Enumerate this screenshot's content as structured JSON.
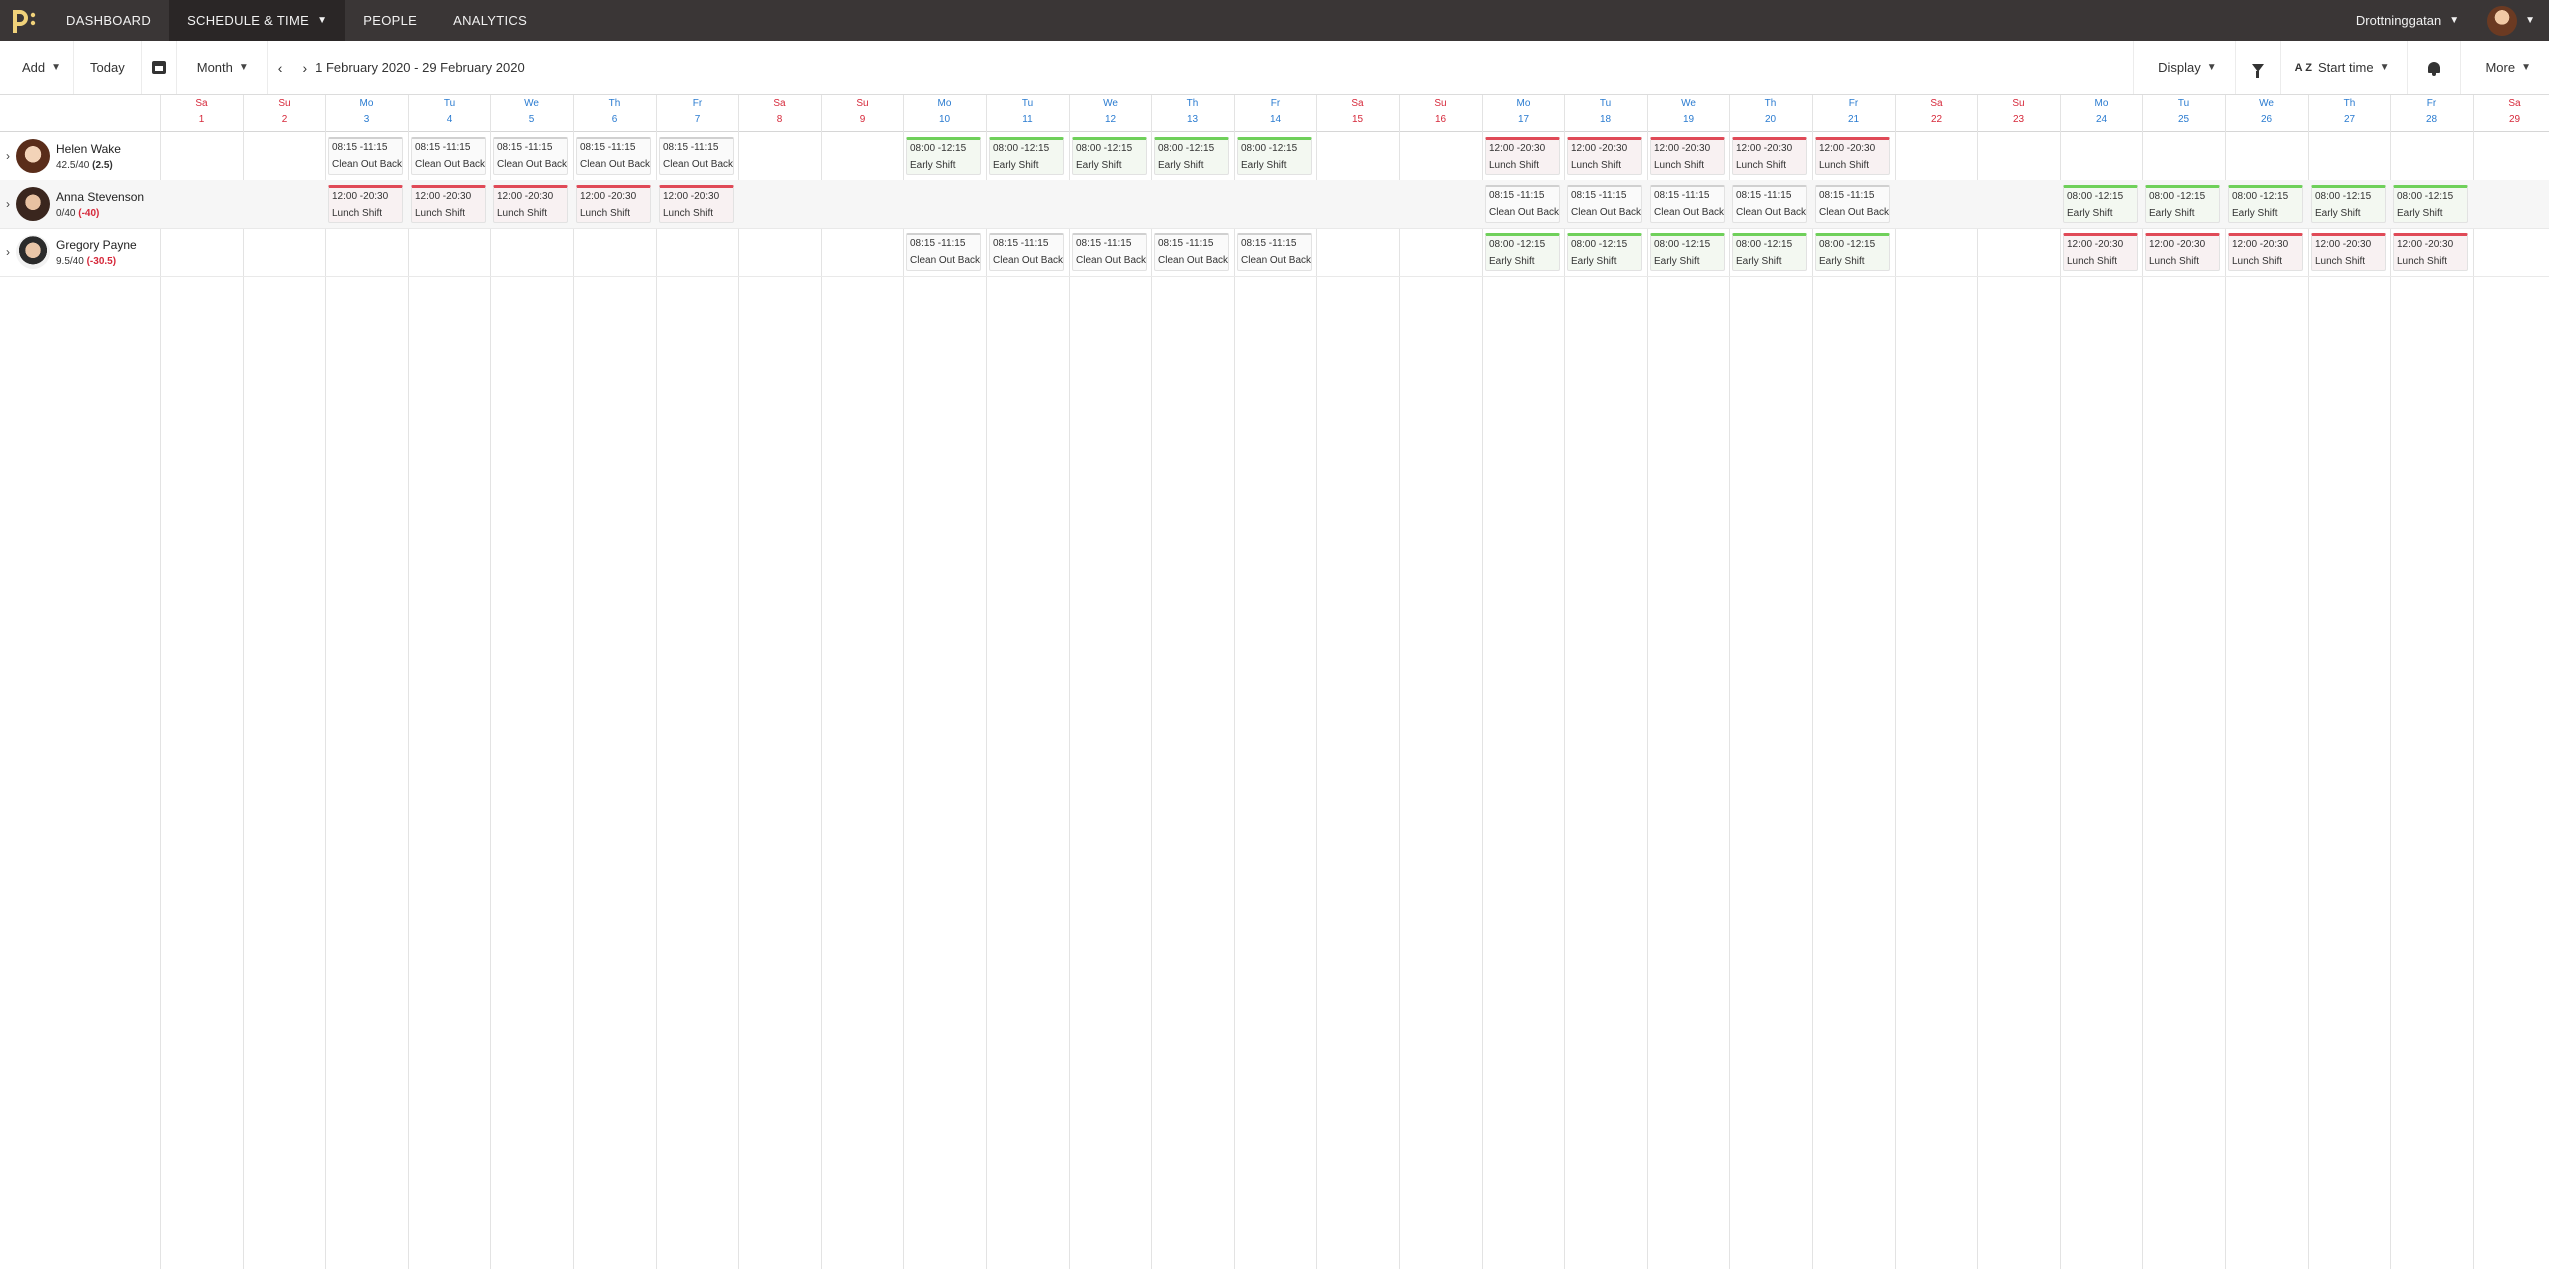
{
  "nav": {
    "items": [
      "DASHBOARD",
      "SCHEDULE & TIME",
      "PEOPLE",
      "ANALYTICS"
    ],
    "active_index": 1,
    "location": "Drottninggatan"
  },
  "toolbar": {
    "add_label": "Add",
    "today_label": "Today",
    "view_label": "Month",
    "date_range": "1 February 2020 - 29 February 2020",
    "display_label": "Display",
    "sort_label": "Start time",
    "sort_icon_text": "A Z",
    "more_label": "More"
  },
  "days": [
    {
      "dn": "Sa",
      "dd": "1",
      "we": true
    },
    {
      "dn": "Su",
      "dd": "2",
      "we": true
    },
    {
      "dn": "Mo",
      "dd": "3",
      "we": false
    },
    {
      "dn": "Tu",
      "dd": "4",
      "we": false
    },
    {
      "dn": "We",
      "dd": "5",
      "we": false
    },
    {
      "dn": "Th",
      "dd": "6",
      "we": false
    },
    {
      "dn": "Fr",
      "dd": "7",
      "we": false
    },
    {
      "dn": "Sa",
      "dd": "8",
      "we": true
    },
    {
      "dn": "Su",
      "dd": "9",
      "we": true
    },
    {
      "dn": "Mo",
      "dd": "10",
      "we": false
    },
    {
      "dn": "Tu",
      "dd": "11",
      "we": false
    },
    {
      "dn": "We",
      "dd": "12",
      "we": false
    },
    {
      "dn": "Th",
      "dd": "13",
      "we": false
    },
    {
      "dn": "Fr",
      "dd": "14",
      "we": false
    },
    {
      "dn": "Sa",
      "dd": "15",
      "we": true
    },
    {
      "dn": "Su",
      "dd": "16",
      "we": true
    },
    {
      "dn": "Mo",
      "dd": "17",
      "we": false
    },
    {
      "dn": "Tu",
      "dd": "18",
      "we": false
    },
    {
      "dn": "We",
      "dd": "19",
      "we": false
    },
    {
      "dn": "Th",
      "dd": "20",
      "we": false
    },
    {
      "dn": "Fr",
      "dd": "21",
      "we": false
    },
    {
      "dn": "Sa",
      "dd": "22",
      "we": true
    },
    {
      "dn": "Su",
      "dd": "23",
      "we": true
    },
    {
      "dn": "Mo",
      "dd": "24",
      "we": false
    },
    {
      "dn": "Tu",
      "dd": "25",
      "we": false
    },
    {
      "dn": "We",
      "dd": "26",
      "we": false
    },
    {
      "dn": "Th",
      "dd": "27",
      "we": false
    },
    {
      "dn": "Fr",
      "dd": "28",
      "we": false
    },
    {
      "dn": "Sa",
      "dd": "29",
      "we": true
    }
  ],
  "colors": {
    "weekday": "#2a7bd0",
    "weekend": "#d6283a",
    "early": "#6fd05a",
    "lunch": "#e04a57"
  },
  "employees": [
    {
      "name": "Helen Wake",
      "hours": "42.5/40",
      "diff": "(2.5)",
      "diff_negative": false
    },
    {
      "name": "Anna Stevenson",
      "hours": "0/40",
      "diff": "(-40)",
      "diff_negative": true
    },
    {
      "name": "Gregory Payne",
      "hours": "9.5/40",
      "diff": "(-30.5)",
      "diff_negative": true
    }
  ],
  "shifts": [
    {
      "row": 0,
      "day": 3,
      "time": "08:15 -11:15",
      "name": "Clean Out Back",
      "kind": "plain"
    },
    {
      "row": 0,
      "day": 4,
      "time": "08:15 -11:15",
      "name": "Clean Out Back",
      "kind": "plain"
    },
    {
      "row": 0,
      "day": 5,
      "time": "08:15 -11:15",
      "name": "Clean Out Back",
      "kind": "plain"
    },
    {
      "row": 0,
      "day": 6,
      "time": "08:15 -11:15",
      "name": "Clean Out Back",
      "kind": "plain"
    },
    {
      "row": 0,
      "day": 7,
      "time": "08:15 -11:15",
      "name": "Clean Out Back",
      "kind": "plain"
    },
    {
      "row": 0,
      "day": 10,
      "time": "08:00 -12:15",
      "name": "Early Shift",
      "kind": "green"
    },
    {
      "row": 0,
      "day": 11,
      "time": "08:00 -12:15",
      "name": "Early Shift",
      "kind": "green"
    },
    {
      "row": 0,
      "day": 12,
      "time": "08:00 -12:15",
      "name": "Early Shift",
      "kind": "green"
    },
    {
      "row": 0,
      "day": 13,
      "time": "08:00 -12:15",
      "name": "Early Shift",
      "kind": "green"
    },
    {
      "row": 0,
      "day": 14,
      "time": "08:00 -12:15",
      "name": "Early Shift",
      "kind": "green"
    },
    {
      "row": 0,
      "day": 17,
      "time": "12:00 -20:30",
      "name": "Lunch Shift",
      "kind": "red"
    },
    {
      "row": 0,
      "day": 18,
      "time": "12:00 -20:30",
      "name": "Lunch Shift",
      "kind": "red"
    },
    {
      "row": 0,
      "day": 19,
      "time": "12:00 -20:30",
      "name": "Lunch Shift",
      "kind": "red"
    },
    {
      "row": 0,
      "day": 20,
      "time": "12:00 -20:30",
      "name": "Lunch Shift",
      "kind": "red"
    },
    {
      "row": 0,
      "day": 21,
      "time": "12:00 -20:30",
      "name": "Lunch Shift",
      "kind": "red"
    },
    {
      "row": 1,
      "day": 3,
      "time": "12:00 -20:30",
      "name": "Lunch Shift",
      "kind": "red"
    },
    {
      "row": 1,
      "day": 4,
      "time": "12:00 -20:30",
      "name": "Lunch Shift",
      "kind": "red"
    },
    {
      "row": 1,
      "day": 5,
      "time": "12:00 -20:30",
      "name": "Lunch Shift",
      "kind": "red"
    },
    {
      "row": 1,
      "day": 6,
      "time": "12:00 -20:30",
      "name": "Lunch Shift",
      "kind": "red"
    },
    {
      "row": 1,
      "day": 7,
      "time": "12:00 -20:30",
      "name": "Lunch Shift",
      "kind": "red"
    },
    {
      "row": 1,
      "day": 17,
      "time": "08:15 -11:15",
      "name": "Clean Out Back",
      "kind": "plain"
    },
    {
      "row": 1,
      "day": 18,
      "time": "08:15 -11:15",
      "name": "Clean Out Back",
      "kind": "plain"
    },
    {
      "row": 1,
      "day": 19,
      "time": "08:15 -11:15",
      "name": "Clean Out Back",
      "kind": "plain"
    },
    {
      "row": 1,
      "day": 20,
      "time": "08:15 -11:15",
      "name": "Clean Out Back",
      "kind": "plain"
    },
    {
      "row": 1,
      "day": 21,
      "time": "08:15 -11:15",
      "name": "Clean Out Back",
      "kind": "plain"
    },
    {
      "row": 1,
      "day": 24,
      "time": "08:00 -12:15",
      "name": "Early Shift",
      "kind": "green"
    },
    {
      "row": 1,
      "day": 25,
      "time": "08:00 -12:15",
      "name": "Early Shift",
      "kind": "green"
    },
    {
      "row": 1,
      "day": 26,
      "time": "08:00 -12:15",
      "name": "Early Shift",
      "kind": "green"
    },
    {
      "row": 1,
      "day": 27,
      "time": "08:00 -12:15",
      "name": "Early Shift",
      "kind": "green"
    },
    {
      "row": 1,
      "day": 28,
      "time": "08:00 -12:15",
      "name": "Early Shift",
      "kind": "green"
    },
    {
      "row": 2,
      "day": 10,
      "time": "08:15 -11:15",
      "name": "Clean Out Back",
      "kind": "plain"
    },
    {
      "row": 2,
      "day": 11,
      "time": "08:15 -11:15",
      "name": "Clean Out Back",
      "kind": "plain"
    },
    {
      "row": 2,
      "day": 12,
      "time": "08:15 -11:15",
      "name": "Clean Out Back",
      "kind": "plain"
    },
    {
      "row": 2,
      "day": 13,
      "time": "08:15 -11:15",
      "name": "Clean Out Back",
      "kind": "plain"
    },
    {
      "row": 2,
      "day": 14,
      "time": "08:15 -11:15",
      "name": "Clean Out Back",
      "kind": "plain"
    },
    {
      "row": 2,
      "day": 17,
      "time": "08:00 -12:15",
      "name": "Early Shift",
      "kind": "green"
    },
    {
      "row": 2,
      "day": 18,
      "time": "08:00 -12:15",
      "name": "Early Shift",
      "kind": "green"
    },
    {
      "row": 2,
      "day": 19,
      "time": "08:00 -12:15",
      "name": "Early Shift",
      "kind": "green"
    },
    {
      "row": 2,
      "day": 20,
      "time": "08:00 -12:15",
      "name": "Early Shift",
      "kind": "green"
    },
    {
      "row": 2,
      "day": 21,
      "time": "08:00 -12:15",
      "name": "Early Shift",
      "kind": "green"
    },
    {
      "row": 2,
      "day": 24,
      "time": "12:00 -20:30",
      "name": "Lunch Shift",
      "kind": "red"
    },
    {
      "row": 2,
      "day": 25,
      "time": "12:00 -20:30",
      "name": "Lunch Shift",
      "kind": "red"
    },
    {
      "row": 2,
      "day": 26,
      "time": "12:00 -20:30",
      "name": "Lunch Shift",
      "kind": "red"
    },
    {
      "row": 2,
      "day": 27,
      "time": "12:00 -20:30",
      "name": "Lunch Shift",
      "kind": "red"
    },
    {
      "row": 2,
      "day": 28,
      "time": "12:00 -20:30",
      "name": "Lunch Shift",
      "kind": "red"
    }
  ]
}
